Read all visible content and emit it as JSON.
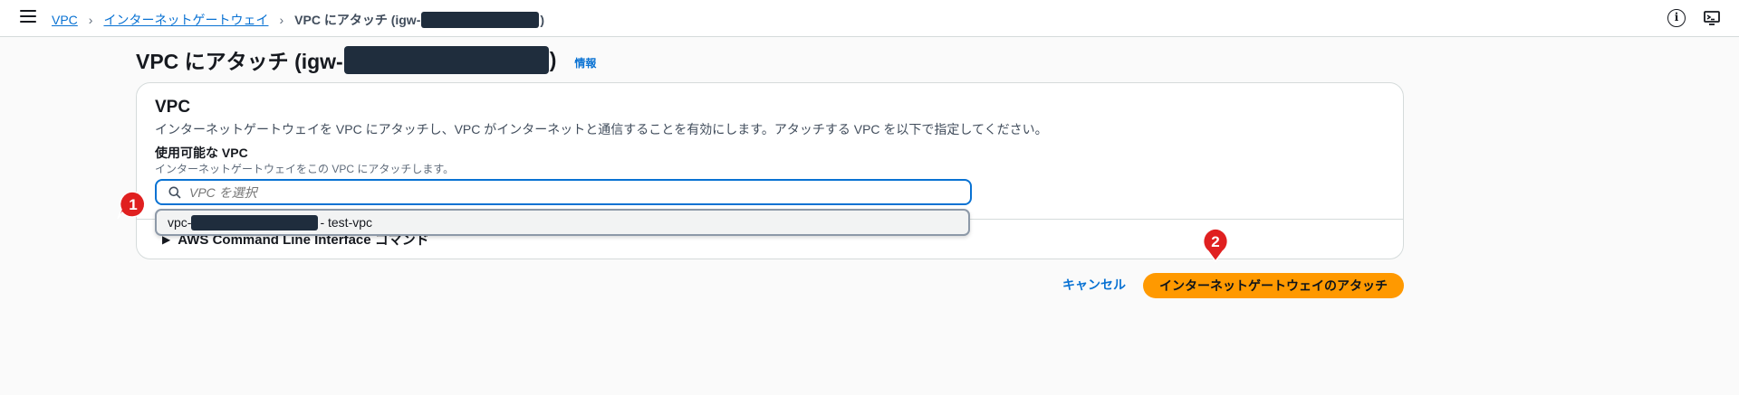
{
  "breadcrumb": {
    "items": [
      "VPC",
      "インターネットゲートウェイ"
    ],
    "current_prefix": "VPC にアタッチ (igw-",
    "current_suffix": ")"
  },
  "page": {
    "title_prefix": "VPC にアタッチ (igw-",
    "title_suffix": ")",
    "info_link": "情報"
  },
  "section": {
    "title": "VPC",
    "description": "インターネットゲートウェイを VPC にアタッチし、VPC がインターネットと通信することを有効にします。アタッチする VPC を以下で指定してください。",
    "field_label": "使用可能な VPC",
    "field_description": "インターネットゲートウェイをこの VPC にアタッチします。",
    "select_placeholder": "VPC を選択",
    "cli_label": "AWS Command Line Interface コマンド"
  },
  "dropdown": {
    "option_prefix": "vpc-",
    "option_suffix": " - test-vpc"
  },
  "actions": {
    "cancel": "キャンセル",
    "attach": "インターネットゲートウェイのアタッチ"
  },
  "markers": [
    "1",
    "2"
  ],
  "icons": {
    "menu": "hamburger-icon",
    "info": "info-icon",
    "console": "cloudshell-icon",
    "search": "search-icon",
    "expand": "caret-right-icon"
  },
  "colors": {
    "link": "#0972d3",
    "primary_button": "#ff9900",
    "focus_border": "#0972d3",
    "marker": "#e02020",
    "redaction": "#1f2d3d"
  }
}
